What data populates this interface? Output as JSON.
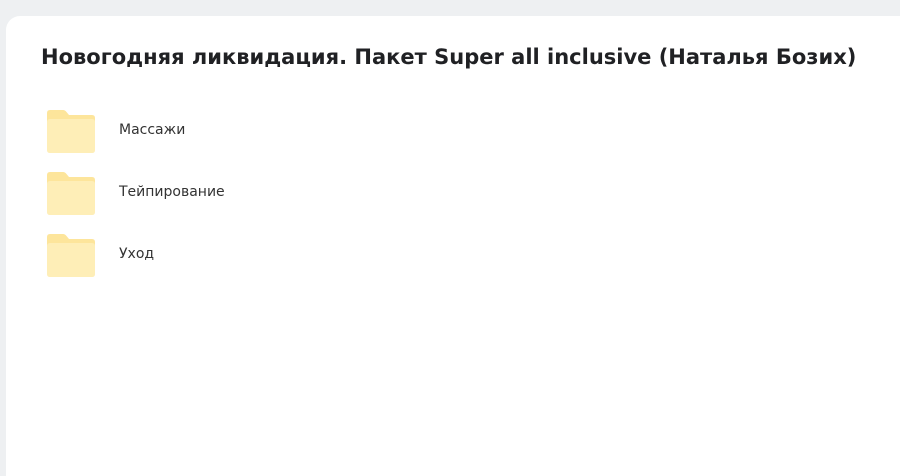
{
  "page": {
    "title": "Новогодняя ликвидация. Пакет Super all inclusive (Наталья Бозих)"
  },
  "folders": [
    {
      "label": "Массажи",
      "icon": "folder-icon"
    },
    {
      "label": "Тейпирование",
      "icon": "folder-icon"
    },
    {
      "label": "Уход",
      "icon": "folder-icon"
    }
  ],
  "colors": {
    "background": "#eef0f2",
    "card": "#ffffff",
    "folder_back": "#fde59b",
    "folder_front": "#feeeb7",
    "text": "#202124"
  }
}
